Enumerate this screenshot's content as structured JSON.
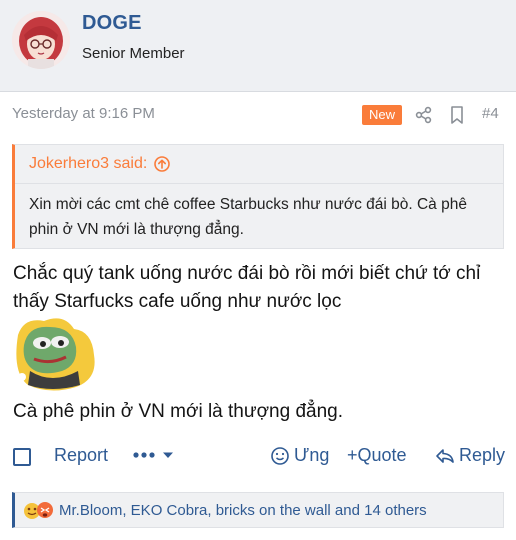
{
  "user": {
    "name": "DOGE",
    "title": "Senior Member"
  },
  "post": {
    "date": "Yesterday at 9:16 PM",
    "badge": "New",
    "number": "#4"
  },
  "quote": {
    "author": "Jokerhero3 said:",
    "text": "Xin mời các cmt chê coffee Starbucks như nước đái bò. Cà phê phin ở VN mới là thượng đẳng."
  },
  "message": {
    "text": "Chắc quý tank uống nước đái bò rồi mới biết chứ tớ chỉ thấy Starfucks cafe uống như nước lọc",
    "text2": "Cà phê phin ở VN mới là thượng đẳng."
  },
  "actions": {
    "report": "Report",
    "react": "Ưng",
    "quote": "+Quote",
    "reply": "Reply"
  },
  "reactions": {
    "list": "Mr.Bloom, EKO Cobra, bricks on the wall and 14 others"
  },
  "colors": {
    "accent": "#2f5a93",
    "badge": "#fa7c3a",
    "header_bg": "#eef0f3"
  }
}
